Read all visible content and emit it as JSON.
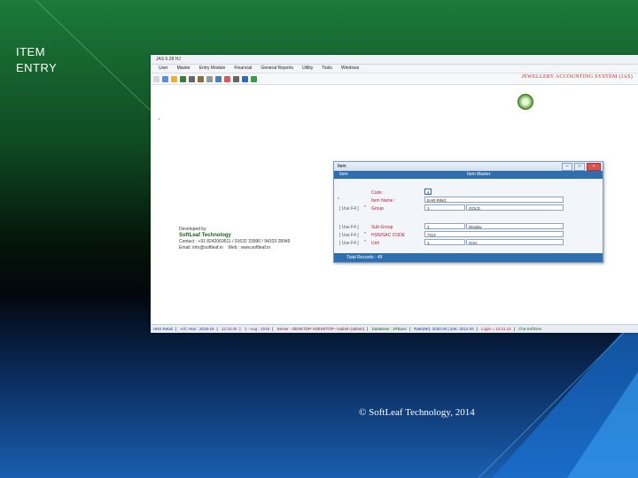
{
  "slide": {
    "title_line1": "ITEM",
    "title_line2": "ENTRY",
    "footer": "© SoftLeaf Technology, 2014"
  },
  "app": {
    "window_title": "JAS 6.28 HJ",
    "menu": [
      "User",
      "Master",
      "Entry Module",
      "Financial",
      "General Reports",
      "Utility",
      "Tools",
      "Windows"
    ],
    "brand": "JEWELLERY ACCOUNTING SYSTEM (JAS)",
    "developed_by": "Developed by",
    "company": "SoftLeaf Technology",
    "contact": "Contact : +91 8242069511 / 91632 33990 / 94333 28949",
    "email": "Email: info@softleaf.in",
    "web": "Web : www.softleaf.in",
    "status": [
      "HMJ Retail",
      "A/C Year : 2018-19",
      "12:15:40",
      "1 - Aug - 2018",
      "Server - DESKTOP->DESKTOP-->admin (admin)",
      "DataBase : JRBase",
      "Rate(9K): 2040.00 | 22K: 3212.00",
      "Login = 13.21.12",
      "Cha-SoftGen"
    ]
  },
  "dialog": {
    "title": "Item",
    "header_left": "Item",
    "header_right": "Item Master",
    "fields": [
      {
        "label": "Code :",
        "value": "4",
        "extra": ""
      },
      {
        "label": "Item Name :",
        "value": "EAR RING",
        "extra": ""
      },
      {
        "label": "Group",
        "value": "1",
        "extra": "GOLD"
      },
      {
        "label": "Sub-Group",
        "value": "1",
        "extra": "Display"
      },
      {
        "label": "HSN/SAC CODE",
        "value": "7113",
        "extra": ""
      },
      {
        "label": "Unit",
        "value": "1",
        "extra": "Gms"
      }
    ],
    "side_tags": [
      "[ Use F4 ]",
      "[ Use F4 ]",
      "[ Use F4 ]",
      "[ Use F4 ]"
    ],
    "footer": "Total Records : 45"
  },
  "colors": {
    "accent": "#2f6fae",
    "required": "#c01c28",
    "brand": "#b03030"
  }
}
